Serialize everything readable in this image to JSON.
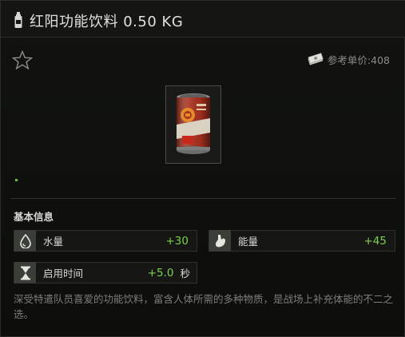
{
  "item": {
    "title": "红阳功能饮料 0.50 KG",
    "price_text": "参考单价:408",
    "section_title": "基本信息",
    "description": "深受特遣队员喜爱的功能饮料，富含人体所需的多种物质，是战场上补充体能的不二之选。"
  },
  "stats": [
    {
      "label": "水量",
      "value": "+30",
      "icon": "water-drop-icon"
    },
    {
      "label": "能量",
      "value": "+45",
      "icon": "stomach-icon"
    },
    {
      "label": "启用时间",
      "value": "+5.0",
      "unit": "秒",
      "icon": "hourglass-icon"
    }
  ],
  "colors": {
    "background": "#0b0c0b",
    "positive_value": "#7dd14a",
    "muted_text": "#7c7e78",
    "item_border": "#4a4c47"
  }
}
